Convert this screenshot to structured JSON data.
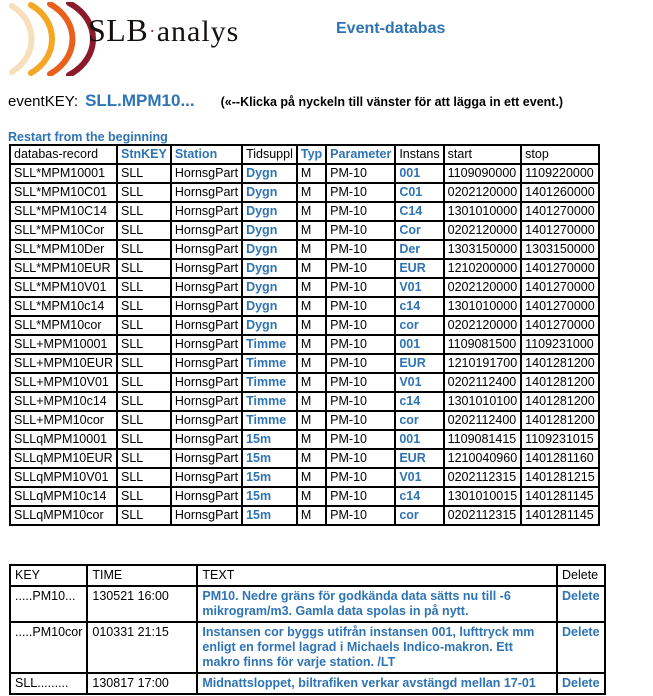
{
  "branding": {
    "name_primary": "SLB",
    "name_separator": "·",
    "name_secondary": "analys",
    "logo_icon": "soundwave-arcs-icon",
    "arc_colors": [
      "#F7DFBB",
      "#F5A623",
      "#E8601C",
      "#8B1A2B"
    ]
  },
  "header": {
    "app_title": "Event-databas",
    "accent_color": "#2E74B5"
  },
  "eventkey": {
    "label": "eventKEY:",
    "value": "SLL.MPM10...",
    "hint": "(«--Klicka på nyckeln till vänster för att lägga in ett event.)"
  },
  "restart": {
    "label": "Restart from the beginning"
  },
  "records": {
    "columns": [
      {
        "label": "databas-record",
        "blue": false
      },
      {
        "label": "StnKEY",
        "blue": true
      },
      {
        "label": "Station",
        "blue": true
      },
      {
        "label": "Tidsuppl",
        "blue": false
      },
      {
        "label": "Typ",
        "blue": true
      },
      {
        "label": "Parameter",
        "blue": true
      },
      {
        "label": "Instans",
        "blue": false
      },
      {
        "label": "start",
        "blue": false
      },
      {
        "label": "stop",
        "blue": false
      }
    ],
    "rows": [
      {
        "record": "SLL*MPM10001",
        "stnkey": "SLL",
        "station": "HornsgPart",
        "tidsuppl": "Dygn",
        "typ": "M",
        "parameter": "PM-10",
        "instans": "001",
        "start": "1109090000",
        "stop": "1109220000"
      },
      {
        "record": "SLL*MPM10C01",
        "stnkey": "SLL",
        "station": "HornsgPart",
        "tidsuppl": "Dygn",
        "typ": "M",
        "parameter": "PM-10",
        "instans": "C01",
        "start": "0202120000",
        "stop": "1401260000"
      },
      {
        "record": "SLL*MPM10C14",
        "stnkey": "SLL",
        "station": "HornsgPart",
        "tidsuppl": "Dygn",
        "typ": "M",
        "parameter": "PM-10",
        "instans": "C14",
        "start": "1301010000",
        "stop": "1401270000"
      },
      {
        "record": "SLL*MPM10Cor",
        "stnkey": "SLL",
        "station": "HornsgPart",
        "tidsuppl": "Dygn",
        "typ": "M",
        "parameter": "PM-10",
        "instans": "Cor",
        "start": "0202120000",
        "stop": "1401270000"
      },
      {
        "record": "SLL*MPM10Der",
        "stnkey": "SLL",
        "station": "HornsgPart",
        "tidsuppl": "Dygn",
        "typ": "M",
        "parameter": "PM-10",
        "instans": "Der",
        "start": "1303150000",
        "stop": "1303150000"
      },
      {
        "record": "SLL*MPM10EUR",
        "stnkey": "SLL",
        "station": "HornsgPart",
        "tidsuppl": "Dygn",
        "typ": "M",
        "parameter": "PM-10",
        "instans": "EUR",
        "start": "1210200000",
        "stop": "1401270000"
      },
      {
        "record": "SLL*MPM10V01",
        "stnkey": "SLL",
        "station": "HornsgPart",
        "tidsuppl": "Dygn",
        "typ": "M",
        "parameter": "PM-10",
        "instans": "V01",
        "start": "0202120000",
        "stop": "1401270000"
      },
      {
        "record": "SLL*MPM10c14",
        "stnkey": "SLL",
        "station": "HornsgPart",
        "tidsuppl": "Dygn",
        "typ": "M",
        "parameter": "PM-10",
        "instans": "c14",
        "start": "1301010000",
        "stop": "1401270000"
      },
      {
        "record": "SLL*MPM10cor",
        "stnkey": "SLL",
        "station": "HornsgPart",
        "tidsuppl": "Dygn",
        "typ": "M",
        "parameter": "PM-10",
        "instans": "cor",
        "start": "0202120000",
        "stop": "1401270000"
      },
      {
        "record": "SLL+MPM10001",
        "stnkey": "SLL",
        "station": "HornsgPart",
        "tidsuppl": "Timme",
        "typ": "M",
        "parameter": "PM-10",
        "instans": "001",
        "start": "1109081500",
        "stop": "1109231000"
      },
      {
        "record": "SLL+MPM10EUR",
        "stnkey": "SLL",
        "station": "HornsgPart",
        "tidsuppl": "Timme",
        "typ": "M",
        "parameter": "PM-10",
        "instans": "EUR",
        "start": "1210191700",
        "stop": "1401281200"
      },
      {
        "record": "SLL+MPM10V01",
        "stnkey": "SLL",
        "station": "HornsgPart",
        "tidsuppl": "Timme",
        "typ": "M",
        "parameter": "PM-10",
        "instans": "V01",
        "start": "0202112400",
        "stop": "1401281200"
      },
      {
        "record": "SLL+MPM10c14",
        "stnkey": "SLL",
        "station": "HornsgPart",
        "tidsuppl": "Timme",
        "typ": "M",
        "parameter": "PM-10",
        "instans": "c14",
        "start": "1301010100",
        "stop": "1401281200"
      },
      {
        "record": "SLL+MPM10cor",
        "stnkey": "SLL",
        "station": "HornsgPart",
        "tidsuppl": "Timme",
        "typ": "M",
        "parameter": "PM-10",
        "instans": "cor",
        "start": "0202112400",
        "stop": "1401281200"
      },
      {
        "record": "SLLqMPM10001",
        "stnkey": "SLL",
        "station": "HornsgPart",
        "tidsuppl": "15m",
        "typ": "M",
        "parameter": "PM-10",
        "instans": "001",
        "start": "1109081415",
        "stop": "1109231015"
      },
      {
        "record": "SLLqMPM10EUR",
        "stnkey": "SLL",
        "station": "HornsgPart",
        "tidsuppl": "15m",
        "typ": "M",
        "parameter": "PM-10",
        "instans": "EUR",
        "start": "1210040960",
        "stop": "1401281160"
      },
      {
        "record": "SLLqMPM10V01",
        "stnkey": "SLL",
        "station": "HornsgPart",
        "tidsuppl": "15m",
        "typ": "M",
        "parameter": "PM-10",
        "instans": "V01",
        "start": "0202112315",
        "stop": "1401281215"
      },
      {
        "record": "SLLqMPM10c14",
        "stnkey": "SLL",
        "station": "HornsgPart",
        "tidsuppl": "15m",
        "typ": "M",
        "parameter": "PM-10",
        "instans": "c14",
        "start": "1301010015",
        "stop": "1401281145"
      },
      {
        "record": "SLLqMPM10cor",
        "stnkey": "SLL",
        "station": "HornsgPart",
        "tidsuppl": "15m",
        "typ": "M",
        "parameter": "PM-10",
        "instans": "cor",
        "start": "0202112315",
        "stop": "1401281145"
      }
    ]
  },
  "events": {
    "columns": [
      "KEY",
      "TIME",
      "TEXT",
      "Delete"
    ],
    "rows": [
      {
        "key": ".....PM10...",
        "time": "130521 16:00",
        "text": "PM10. Nedre gräns för godkända data sätts nu till -6 mikrogram/m3. Gamla data spolas in på nytt.",
        "delete": "Delete"
      },
      {
        "key": ".....PM10cor",
        "time": "010331 21:15",
        "text": "Instansen cor byggs utifrån instansen 001, lufttryck mm enligt en formel lagrad i Michaels Indico-makron. Ett makro finns för varje station. /LT",
        "delete": "Delete"
      },
      {
        "key": "SLL.........",
        "time": "130817 17:00",
        "text": "Midnattsloppet, biltrafiken verkar avstängd mellan 17-01",
        "delete": "Delete"
      }
    ]
  }
}
